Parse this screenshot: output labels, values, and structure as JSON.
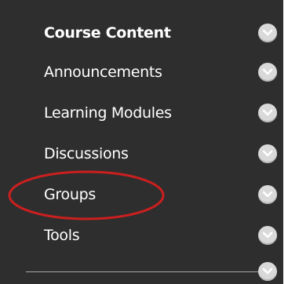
{
  "menu": {
    "items": [
      {
        "label": "Course Content",
        "active": true,
        "icon": "chevron-down-icon"
      },
      {
        "label": "Announcements",
        "active": false,
        "icon": "chevron-down-icon"
      },
      {
        "label": "Learning Modules",
        "active": false,
        "icon": "chevron-down-icon"
      },
      {
        "label": "Discussions",
        "active": false,
        "icon": "chevron-down-icon"
      },
      {
        "label": "Groups",
        "active": false,
        "icon": "chevron-down-icon"
      },
      {
        "label": "Tools",
        "active": false,
        "icon": "chevron-down-icon"
      }
    ]
  },
  "annotation": {
    "shape": "oval",
    "color": "#cc1f1f",
    "target": "Groups"
  },
  "colors": {
    "panel_background": "#2e2e2e",
    "text": "#ffffff",
    "chevron_button": "#d9d9d9"
  }
}
